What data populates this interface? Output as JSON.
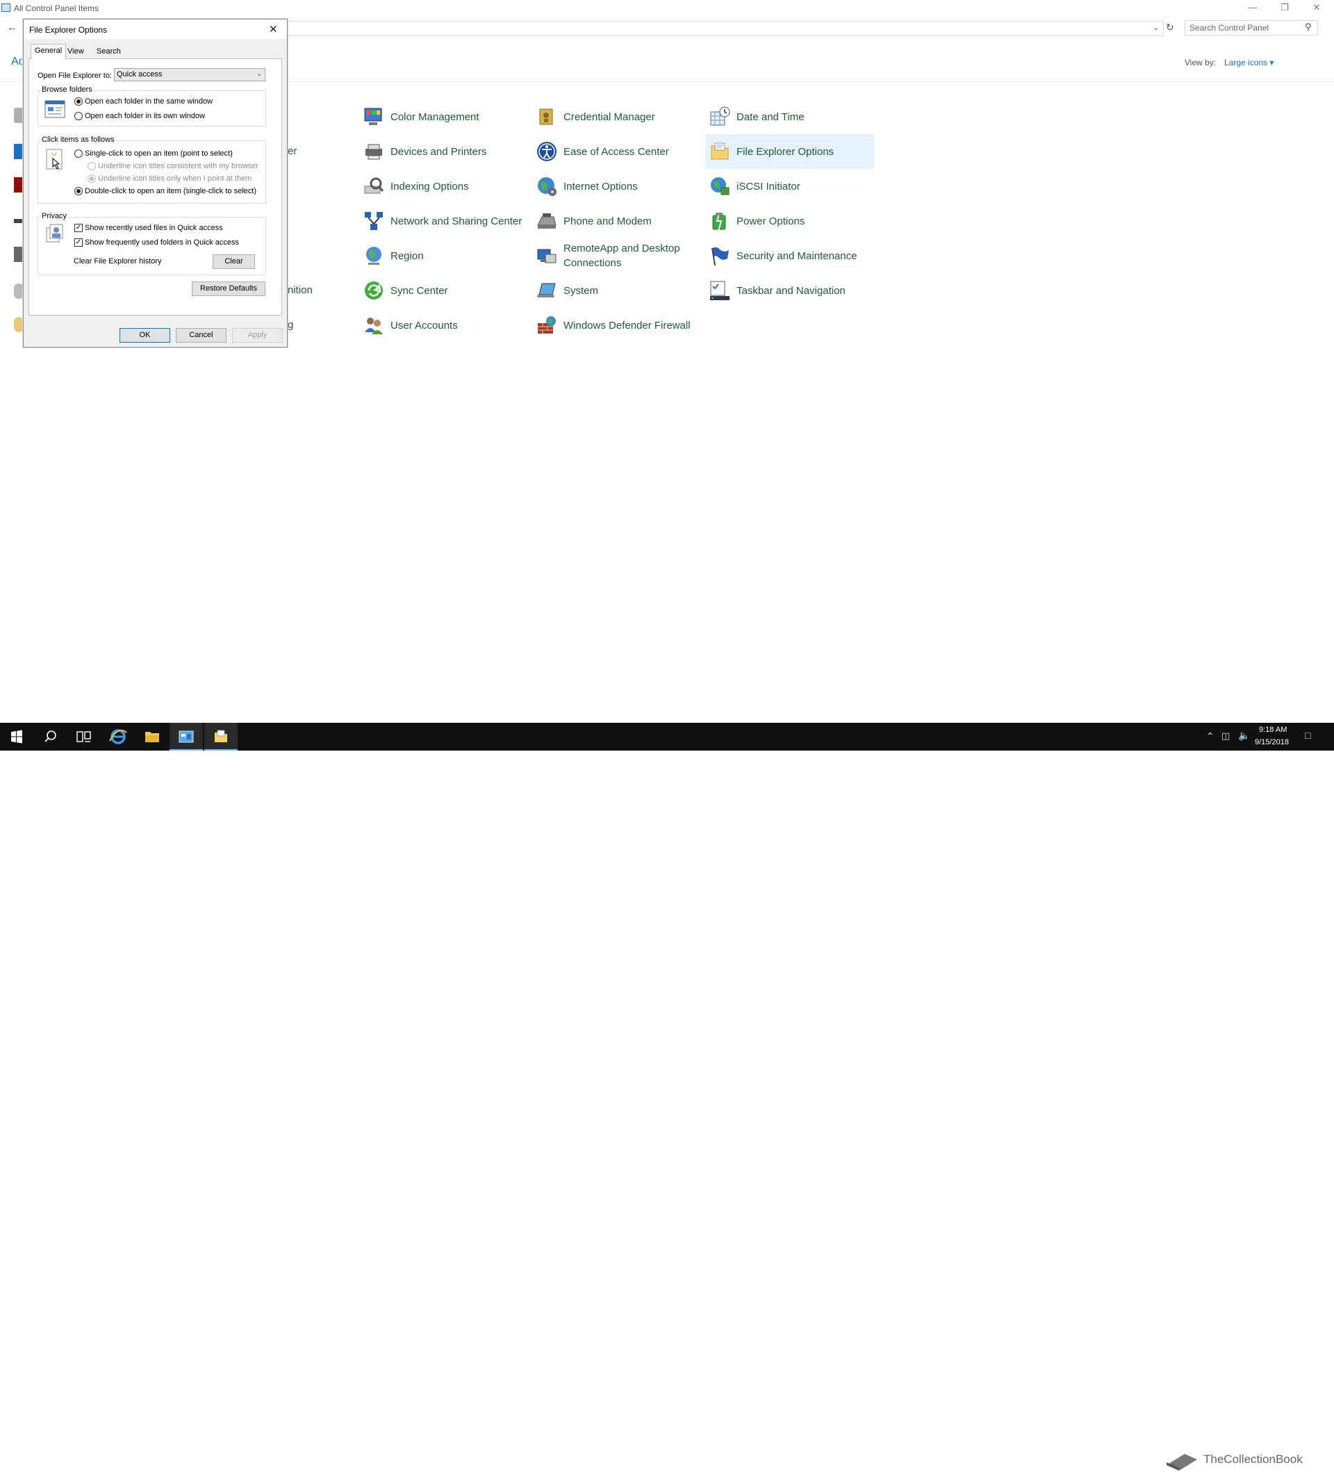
{
  "window": {
    "title": "All Control Panel Items",
    "search_placeholder": "Search Control Panel",
    "adjust_link": "Ad",
    "view_by_label": "View by:",
    "view_by_value": "Large icons ▾"
  },
  "items": [
    {
      "label": "Color Management",
      "icon": "color-management-icon"
    },
    {
      "label": "Credential Manager",
      "icon": "credential-manager-icon"
    },
    {
      "label": "Date and Time",
      "icon": "date-time-icon"
    },
    {
      "label": "Devices and Printers",
      "icon": "devices-printers-icon"
    },
    {
      "label": "Ease of Access Center",
      "icon": "ease-of-access-icon"
    },
    {
      "label": "File Explorer Options",
      "icon": "file-explorer-options-icon"
    },
    {
      "label": "Indexing Options",
      "icon": "indexing-options-icon"
    },
    {
      "label": "Internet Options",
      "icon": "internet-options-icon"
    },
    {
      "label": "iSCSI Initiator",
      "icon": "iscsi-initiator-icon"
    },
    {
      "label": "Network and Sharing Center",
      "icon": "network-sharing-icon"
    },
    {
      "label": "Phone and Modem",
      "icon": "phone-modem-icon"
    },
    {
      "label": "Power Options",
      "icon": "power-options-icon"
    },
    {
      "label": "Region",
      "icon": "region-icon"
    },
    {
      "label": "RemoteApp and Desktop Connections",
      "icon": "remoteapp-icon"
    },
    {
      "label": "Security and Maintenance",
      "icon": "security-maintenance-icon"
    },
    {
      "label": "Sync Center",
      "icon": "sync-center-icon"
    },
    {
      "label": "System",
      "icon": "system-icon"
    },
    {
      "label": "Taskbar and Navigation",
      "icon": "taskbar-navigation-icon"
    },
    {
      "label": "User Accounts",
      "icon": "user-accounts-icon"
    },
    {
      "label": "Windows Defender Firewall",
      "icon": "firewall-icon"
    }
  ],
  "clipped": {
    "er": "er",
    "nition": "nition",
    "g": "g"
  },
  "dialog": {
    "title": "File Explorer Options",
    "tabs": [
      "General",
      "View",
      "Search"
    ],
    "open_label": "Open File Explorer to:",
    "open_value": "Quick access",
    "browse_group": "Browse folders",
    "browse_same": "Open each folder in the same window",
    "browse_own": "Open each folder in its own window",
    "click_group": "Click items as follows",
    "single_click": "Single-click to open an item (point to select)",
    "underline_browser": "Underline icon titles consistent with my browser",
    "underline_point": "Underline icon titles only when I point at them",
    "double_click": "Double-click to open an item (single-click to select)",
    "privacy_group": "Privacy",
    "show_recent_files": "Show recently used files in Quick access",
    "show_frequent_folders": "Show frequently used folders in Quick access",
    "clear_history_label": "Clear File Explorer history",
    "clear_btn": "Clear",
    "restore_btn": "Restore Defaults",
    "ok_btn": "OK",
    "cancel_btn": "Cancel",
    "apply_btn": "Apply"
  },
  "taskbar": {
    "time": "9:18 AM",
    "date": "9/15/2018",
    "watermark": "TheCollectionBook"
  },
  "colors": {
    "link": "#1e6fc2",
    "item_text": "#1f5a34",
    "selected_bg": "#e5f1fb",
    "taskbar_bg": "#101010"
  }
}
